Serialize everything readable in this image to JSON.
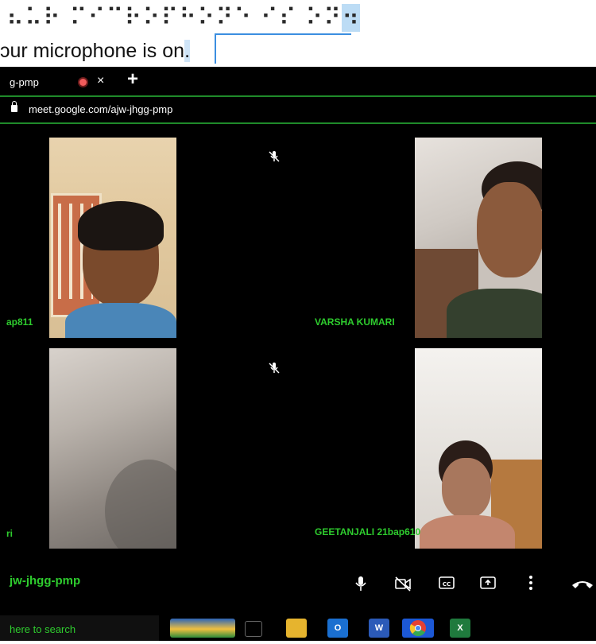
{
  "braille": {
    "display_text": "⠦⠥⠗ ⠍⠊⠉⠗⠕⠏⠓⠕⠝⠑ ⠊⠎ ⠕⠝",
    "cursor_cell": "⠲"
  },
  "status": {
    "prefix": "ɔur microphone is on",
    "suffix": "."
  },
  "browser": {
    "tab_title": "g-pmp",
    "tab_close": "×",
    "new_tab": "+",
    "url": "meet.google.com/ajw-jhgg-pmp"
  },
  "meet": {
    "tiles": [
      {
        "name": "ap811"
      },
      {
        "name": "VARSHA KUMARI"
      },
      {
        "name": "ri"
      },
      {
        "name": "GEETANJALI 21bap610"
      }
    ],
    "meeting_code": "jw-jhgg-pmp",
    "controls": {
      "mic": "microphone-icon",
      "camera": "camera-off-icon",
      "captions": "captions-icon",
      "present": "present-icon",
      "more": "more-options-icon",
      "leave": "leave-call-icon"
    }
  },
  "taskbar": {
    "search_placeholder": "here to search",
    "apps": [
      "task-view-icon",
      "file-explorer-icon",
      "outlook-icon",
      "word-icon",
      "chrome-icon",
      "excel-icon"
    ]
  },
  "colors": {
    "accent_green": "#2ecc2e",
    "rec_red": "#f05b5b"
  }
}
